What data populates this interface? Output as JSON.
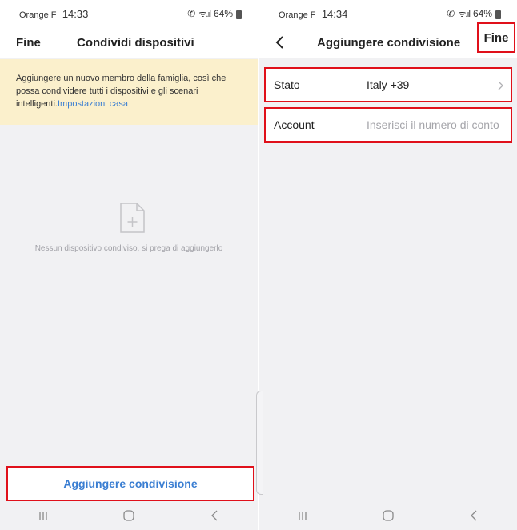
{
  "left": {
    "status": {
      "carrier": "Orange F",
      "time": "14:33",
      "battery": "64%"
    },
    "nav": {
      "left_btn": "Fine",
      "title": "Condividi dispositivi"
    },
    "banner": {
      "text": "Aggiungere un nuovo membro della famiglia, così che possa condividere tutti i dispositivi e gli scenari intelligenti.",
      "link": "Impostazioni casa"
    },
    "empty": {
      "icon": "add-file-icon",
      "text": "Nessun dispositivo condiviso, si prega di aggiungerlo"
    },
    "add_button": "Aggiungere condivisione"
  },
  "right": {
    "status": {
      "carrier": "Orange F",
      "time": "14:34",
      "battery": "64%"
    },
    "nav": {
      "back_icon": "chevron-left-icon",
      "title": "Aggiungere condivisione",
      "right_btn": "Fine"
    },
    "rows": {
      "stato": {
        "label": "Stato",
        "value": "Italy +39"
      },
      "account": {
        "label": "Account",
        "placeholder": "Inserisci il numero di conto"
      }
    }
  },
  "colors": {
    "accent": "#3a7ed2",
    "highlight": "#e0101a",
    "banner": "#fbf0cc"
  }
}
